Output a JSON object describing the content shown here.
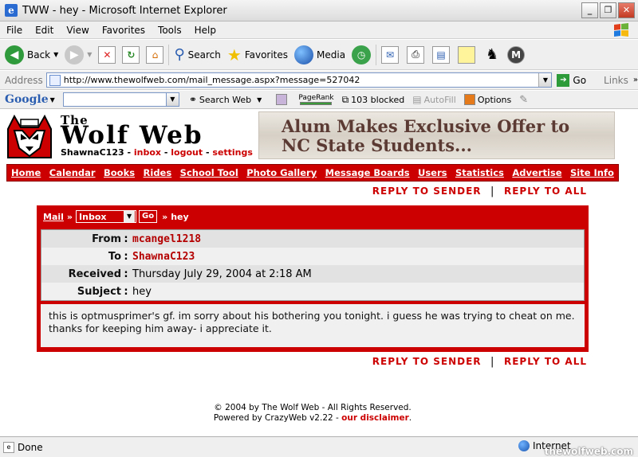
{
  "window": {
    "title": "TWW - hey - Microsoft Internet Explorer",
    "buttons": [
      "_",
      "❐",
      "✕"
    ]
  },
  "menu": [
    "File",
    "Edit",
    "View",
    "Favorites",
    "Tools",
    "Help"
  ],
  "toolbar": {
    "back": "Back",
    "search": "Search",
    "favorites": "Favorites",
    "media": "Media"
  },
  "address": {
    "label": "Address",
    "url": "http://www.thewolfweb.com/mail_message.aspx?message=527042",
    "go": "Go",
    "links": "Links"
  },
  "google_bar": {
    "logo": "Google",
    "search_web": "Search Web",
    "pagerank": "PageRank",
    "blocked": "103 blocked",
    "autofill": "AutoFill",
    "options": "Options"
  },
  "site": {
    "the": "The",
    "name": "Wolf Web",
    "username": "ShawnaC123",
    "links": {
      "inbox": "inbox",
      "logout": "logout",
      "settings": "settings"
    },
    "banner": {
      "line1": "Alum Makes Exclusive Offer to",
      "line2": "NC State Students..."
    }
  },
  "nav": [
    "Home",
    "Calendar",
    "Books",
    "Rides",
    "School Tool",
    "Photo Gallery",
    "Message Boards",
    "Users",
    "Statistics",
    "Advertise",
    "Site Info"
  ],
  "actions": {
    "reply_sender": "Reply To Sender",
    "reply_all": "Reply To All",
    "separator": "|"
  },
  "mail": {
    "breadcrumb_mail": "Mail",
    "folder": "Inbox",
    "go": "Go",
    "subject_crumb": "hey",
    "fields": {
      "from_label": "From",
      "from": "mcangel1218",
      "to_label": "To",
      "to": "ShawnaC123",
      "received_label": "Received",
      "received": "Thursday July 29, 2004 at 2:18 AM",
      "subject_label": "Subject",
      "subject": "hey"
    },
    "body": "this is optmusprimer's gf. im sorry about his bothering you tonight. i guess he was trying to cheat on me. thanks for keeping him away- i appreciate it."
  },
  "footer": {
    "line1": "© 2004 by The Wolf Web - All Rights Reserved.",
    "line2": "Powered by CrazyWeb v2.22 - ",
    "disclaimer": "our disclaimer"
  },
  "status": {
    "done": "Done",
    "zone": "Internet",
    "watermark": "thewolfweb.com"
  },
  "colors": {
    "brand_red": "#cc0000",
    "link_red": "#b40000"
  }
}
